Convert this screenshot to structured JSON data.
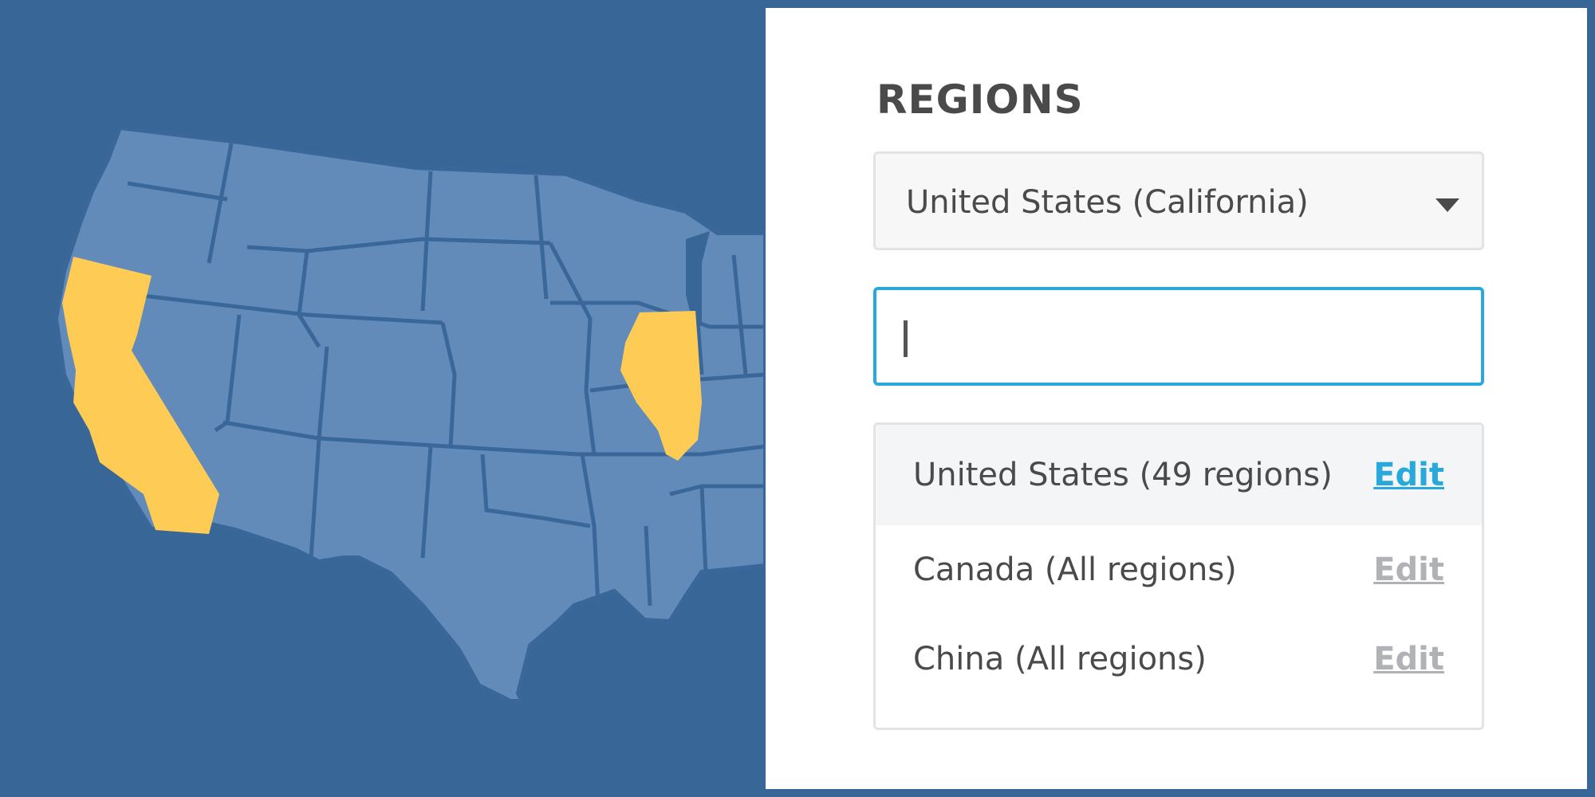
{
  "colors": {
    "background": "#386697",
    "state_fill": "#628bba",
    "state_border": "#3a6799",
    "highlight_state": "#fecb55",
    "accent": "#29a8dc"
  },
  "map": {
    "highlighted_states": [
      "California",
      "Illinois"
    ]
  },
  "panel": {
    "title": "REGIONS",
    "select": {
      "value": "United States (California)",
      "icon": "chevron-down-icon"
    },
    "search": {
      "value": "",
      "placeholder": ""
    },
    "regions": [
      {
        "label": "United States (49 regions)",
        "edit_label": "Edit",
        "active": true
      },
      {
        "label": "Canada (All regions)",
        "edit_label": "Edit",
        "active": false
      },
      {
        "label": "China (All regions)",
        "edit_label": "Edit",
        "active": false
      }
    ]
  }
}
